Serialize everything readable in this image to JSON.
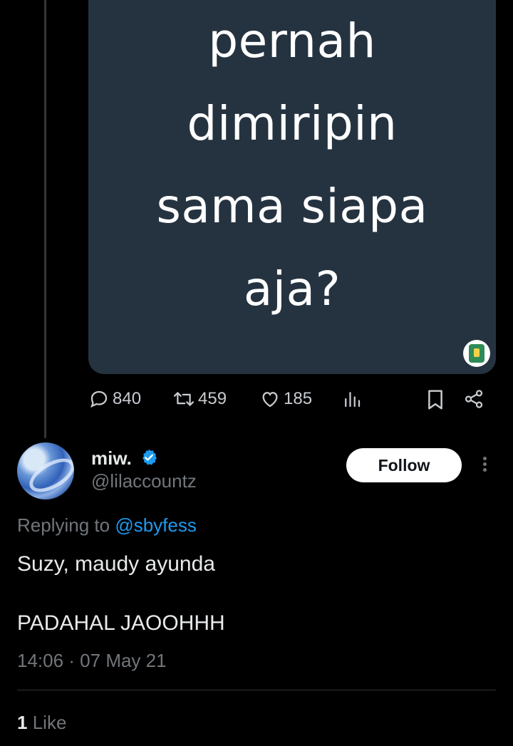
{
  "media": {
    "lines": [
      "pernah",
      "dimiripin",
      "sama siapa",
      "aja?"
    ],
    "badge_icon": "city-emblem-icon"
  },
  "actions": {
    "replies": "840",
    "retweets": "459",
    "likes": "185"
  },
  "reply": {
    "display_name": "miw.",
    "handle": "@lilaccountz",
    "verified": true,
    "follow_label": "Follow",
    "replying_prefix": "Replying to",
    "replying_to": "@sbyfess",
    "text_line1": "Suzy, maudy ayunda",
    "text_line2": "PADAHAL JAOOHHH",
    "timestamp": "14:06 · 07 May 21",
    "like_count": "1",
    "like_label": "Like"
  },
  "colors": {
    "background": "#000000",
    "card": "#253341",
    "accent": "#1d9bf0",
    "muted": "#71767b"
  }
}
